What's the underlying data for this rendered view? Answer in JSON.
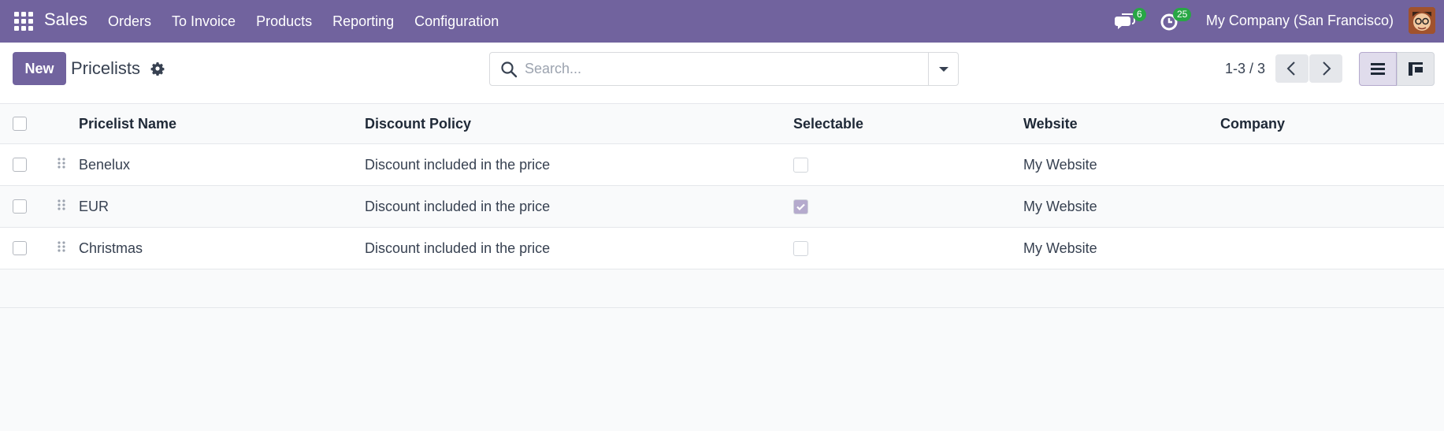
{
  "navbar": {
    "app_name": "Sales",
    "menu": [
      "Orders",
      "To Invoice",
      "Products",
      "Reporting",
      "Configuration"
    ],
    "messages_count": "6",
    "activities_count": "25",
    "company": "My Company (San Francisco)",
    "bg_color": "#71639e"
  },
  "control": {
    "new_label": "New",
    "title": "Pricelists",
    "search_placeholder": "Search...",
    "pager": "1-3 / 3"
  },
  "table": {
    "headers": [
      "Pricelist Name",
      "Discount Policy",
      "Selectable",
      "Website",
      "Company"
    ],
    "rows": [
      {
        "name": "Benelux",
        "policy": "Discount included in the price",
        "selectable": false,
        "website": "My Website",
        "company": ""
      },
      {
        "name": "EUR",
        "policy": "Discount included in the price",
        "selectable": true,
        "website": "My Website",
        "company": ""
      },
      {
        "name": "Christmas",
        "policy": "Discount included in the price",
        "selectable": false,
        "website": "My Website",
        "company": ""
      }
    ]
  }
}
